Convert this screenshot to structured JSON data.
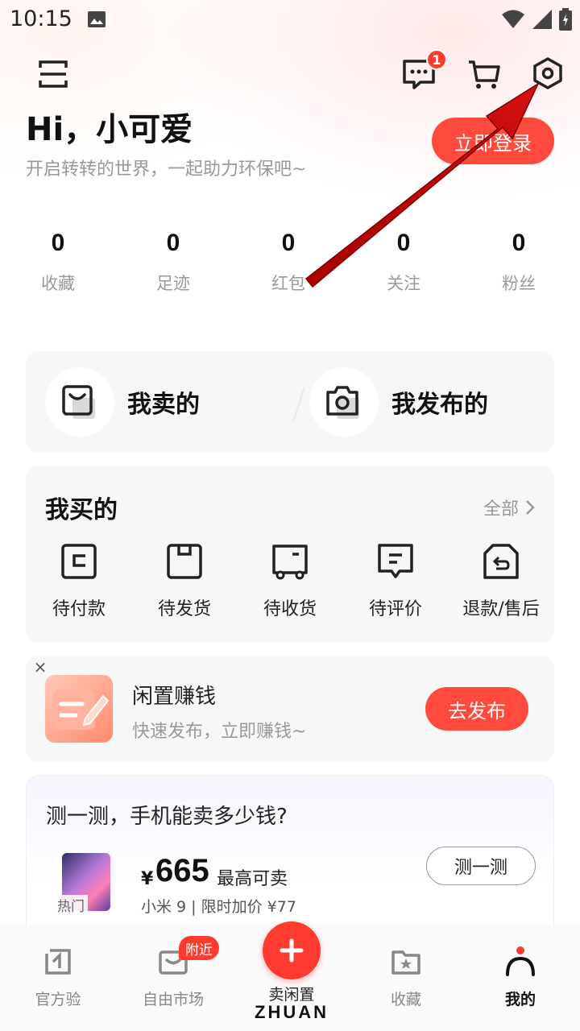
{
  "status_bar": {
    "time": "10:15"
  },
  "header": {
    "message_badge": "1",
    "greeting": "Hi，小可爱",
    "subtitle": "开启转转的世界，一起助力环保吧~",
    "login_label": "立即登录"
  },
  "stats": [
    {
      "value": "0",
      "label": "收藏"
    },
    {
      "value": "0",
      "label": "足迹"
    },
    {
      "value": "0",
      "label": "红包"
    },
    {
      "value": "0",
      "label": "关注"
    },
    {
      "value": "0",
      "label": "粉丝"
    }
  ],
  "sell_card": {
    "sold_label": "我卖的",
    "published_label": "我发布的"
  },
  "buy_card": {
    "title": "我买的",
    "all_label": "全部",
    "items": [
      {
        "label": "待付款",
        "icon": "wallet-icon"
      },
      {
        "label": "待发货",
        "icon": "box-icon"
      },
      {
        "label": "待收货",
        "icon": "truck-icon"
      },
      {
        "label": "待评价",
        "icon": "comment-icon"
      },
      {
        "label": "退款/售后",
        "icon": "return-icon"
      }
    ]
  },
  "promo": {
    "close": "×",
    "title": "闲置赚钱",
    "subtitle": "快速发布，立即赚钱~",
    "button": "去发布"
  },
  "price_test": {
    "title": "测一测，手机能卖多少钱?",
    "hot_tag": "热门",
    "currency": "¥",
    "price": "665",
    "price_note": "最高可卖",
    "model_line": "小米 9 | 限时加价 ¥77",
    "button": "测一测"
  },
  "bottom_nav": {
    "items": [
      {
        "label": "官方验",
        "icon": "verify-icon"
      },
      {
        "label": "自由市场",
        "icon": "market-icon"
      },
      {
        "label": "收藏",
        "icon": "favorite-folder-icon"
      },
      {
        "label": "我的",
        "icon": "profile-icon"
      }
    ],
    "market_badge": "附近",
    "center_label": "卖闲置",
    "brand": "ZHUAN"
  },
  "colors": {
    "accent": "#ff4a3d",
    "badge": "#ff3b30",
    "annotation": "#c40000"
  }
}
